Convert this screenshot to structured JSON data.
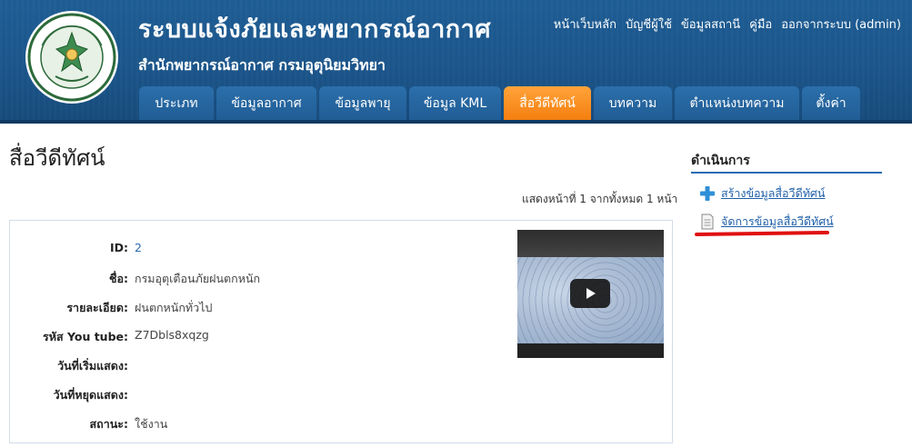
{
  "header": {
    "site_title": "ระบบแจ้งภัยและพยากรณ์อากาศ",
    "site_subtitle": "สำนักพยากรณ์อากาศ กรมอุตุนิยมวิทยา",
    "logo_icon": "meteorological-department-seal-icon",
    "top_links": [
      "หน้าเว็บหลัก",
      "บัญชีผู้ใช้",
      "ข้อมูลสถานี",
      "คู่มือ",
      "ออกจากระบบ (admin)"
    ],
    "nav_tabs": [
      {
        "label": "ประเภท",
        "active": false
      },
      {
        "label": "ข้อมูลอากาศ",
        "active": false
      },
      {
        "label": "ข้อมูลพายุ",
        "active": false
      },
      {
        "label": "ข้อมูล KML",
        "active": false
      },
      {
        "label": "สื่อวีดีทัศน์",
        "active": true
      },
      {
        "label": "บทความ",
        "active": false
      },
      {
        "label": "ตำแหน่งบทความ",
        "active": false
      },
      {
        "label": "ตั้งค่า",
        "active": false
      }
    ],
    "colors": {
      "header_bg": "#1b5489",
      "tab_bg": "#215d95",
      "tab_active": "#f57f10"
    }
  },
  "main": {
    "page_title": "สื่อวีดีทัศน์",
    "pager": "แสดงหน้าที่ 1 จากทั้งหมด 1 หน้า",
    "record": {
      "fields": [
        {
          "label": "ID:",
          "value": "2"
        },
        {
          "label": "ชื่อ:",
          "value": "กรมอุตุเตือนภัยฝนตกหนัก"
        },
        {
          "label": "รายละเอียด:",
          "value": "ฝนตกหนักทั่วไป"
        },
        {
          "label": "รหัส You tube:",
          "value": "Z7Dbls8xqzg"
        },
        {
          "label": "วันที่เริ่มแสดง:",
          "value": ""
        },
        {
          "label": "วันที่หยุดแสดง:",
          "value": ""
        },
        {
          "label": "สถานะ:",
          "value": "ใช้งาน"
        }
      ],
      "video_thumbnail_icon": "play-icon"
    }
  },
  "sidebar": {
    "title": "ดำเนินการ",
    "actions": [
      {
        "label": "สร้างข้อมูลสื่อวีดีทัศน์",
        "icon": "plus-icon"
      },
      {
        "label": "จัดการข้อมูลสื่อวีดีทัศน์",
        "icon": "document-icon"
      }
    ],
    "highlight_color": "#e01010"
  }
}
